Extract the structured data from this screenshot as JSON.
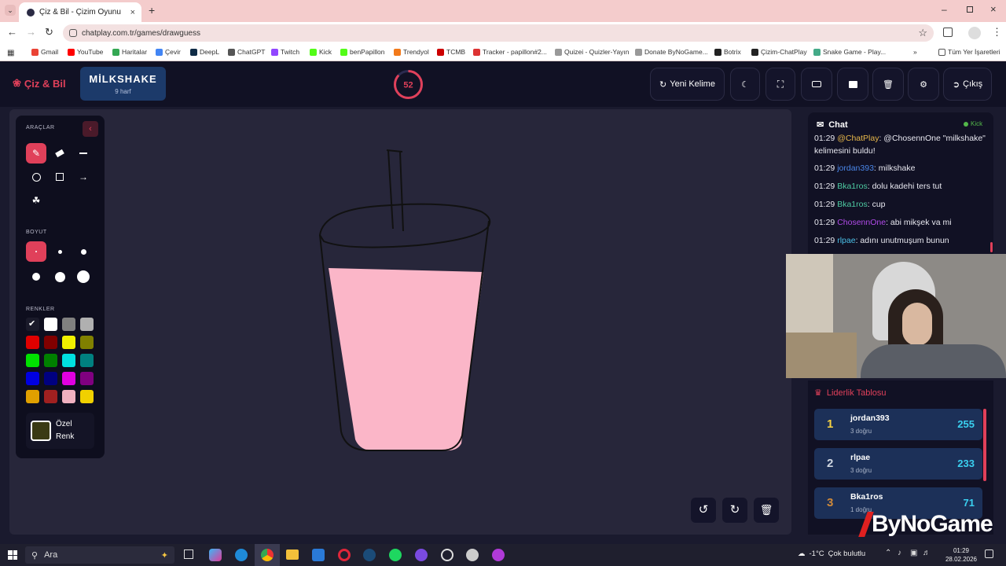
{
  "browser": {
    "tab_title": "Çiz & Bil - Çizim Oyunu",
    "url": "chatplay.com.tr/games/drawguess",
    "bookmarks": [
      "Gmail",
      "YouTube",
      "Haritalar",
      "Çevir",
      "DeepL",
      "ChatGPT",
      "Twitch",
      "Kick",
      "benPapillon",
      "Trendyol",
      "TCMB",
      "Tracker - papillon#2...",
      "Quizei - Quizler-Yayın",
      "Donate ByNoGame...",
      "Botrix",
      "Çizim-ChatPlay",
      "Snake Game - Play..."
    ],
    "all_bookmarks": "Tüm Yer İşaretleri"
  },
  "header": {
    "logo": "Çiz & Bil",
    "word": "MİLKSHAKE",
    "word_sub": "9 harf",
    "timer": "52",
    "timer_fraction": 0.87,
    "new_word": "Yeni Kelime",
    "exit": "Çıkış"
  },
  "tools": {
    "tools_title": "ARAÇLAR",
    "size_title": "BOYUT",
    "colors_title": "RENKLER",
    "custom_color": "Özel Renk",
    "custom_color_value": "#3a3a14",
    "colors": [
      "#1a1a2a",
      "#ffffff",
      "#808080",
      "#b0b0b0",
      "#e00000",
      "#800000",
      "#f0f000",
      "#808000",
      "#00e000",
      "#008000",
      "#00e0e0",
      "#008080",
      "#0000e0",
      "#000080",
      "#e000e0",
      "#800080",
      "#e0a000",
      "#a02020",
      "#f0b0c0",
      "#f0d000"
    ]
  },
  "chat": {
    "title": "Chat",
    "source": "Kick",
    "messages": [
      {
        "time": "01:29",
        "user": "@ChatPlay",
        "text": ": @ChosennOne \"milkshake\" kelimesini buldu!",
        "color": "#e8b84a"
      },
      {
        "time": "01:29",
        "user": "jordan393",
        "text": ": milkshake",
        "color": "#4a86e8"
      },
      {
        "time": "01:29",
        "user": "Bka1ros",
        "text": ": dolu kadehi ters tut",
        "color": "#4ecca3"
      },
      {
        "time": "01:29",
        "user": "Bka1ros",
        "text": ": cup",
        "color": "#4ecca3"
      },
      {
        "time": "01:29",
        "user": "ChosennOne",
        "text": ": abi mikşek va mi",
        "color": "#b04ae8"
      },
      {
        "time": "01:29",
        "user": "rlpae",
        "text": ": adını unutmuşum bunun",
        "color": "#4ac0e8"
      }
    ]
  },
  "leaderboard": {
    "title": "Liderlik Tablosu",
    "rows": [
      {
        "rank": "1",
        "name": "jordan393",
        "sub": "3 doğru",
        "score": "255",
        "rank_color": "#f5d142"
      },
      {
        "rank": "2",
        "name": "rlpae",
        "sub": "3 doğru",
        "score": "233",
        "rank_color": "#cfd6e0"
      },
      {
        "rank": "3",
        "name": "Bka1ros",
        "sub": "1 doğru",
        "score": "71",
        "rank_color": "#d08a3a"
      }
    ]
  },
  "watermark": "ByNoGame",
  "taskbar": {
    "search": "Ara",
    "weather_temp": "-1°C",
    "weather_text": "Çok bulutlu",
    "time": "01:29",
    "date": "28.02.2026"
  },
  "colors": {
    "accent": "#e0405a",
    "drink": "#fbb6c8",
    "canvas": "#27263a"
  }
}
